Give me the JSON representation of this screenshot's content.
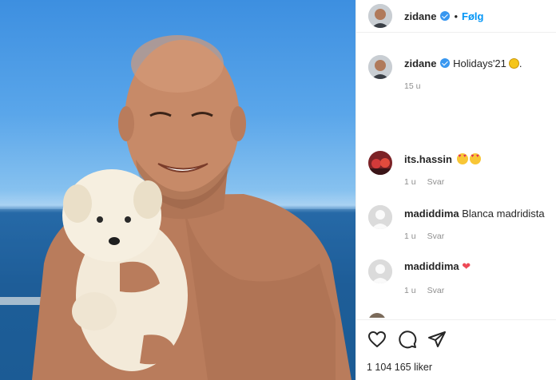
{
  "post": {
    "author": "zidane",
    "follow_label": "Følg",
    "dot": "•",
    "caption": "Holidays'21",
    "caption_time": "15 u",
    "likes": "1 104 165 liker"
  },
  "comments": [
    {
      "user": "its.hassin",
      "text": "",
      "time": "1 u",
      "reply": "Svar"
    },
    {
      "user": "madiddima",
      "text": "Blanca madridista",
      "time": "1 u",
      "reply": "Svar"
    },
    {
      "user": "madiddima",
      "text": "",
      "time": "1 u",
      "reply": "Svar"
    }
  ],
  "icons": {
    "like": "heart-outline-icon",
    "comment": "comment-icon",
    "share": "paper-plane-icon",
    "verified": "verified-badge-icon"
  },
  "colors": {
    "verified": "#3897f0",
    "follow": "#0095f6",
    "text": "#262626",
    "muted": "#8e8e8e",
    "heart": "#ed4956"
  }
}
